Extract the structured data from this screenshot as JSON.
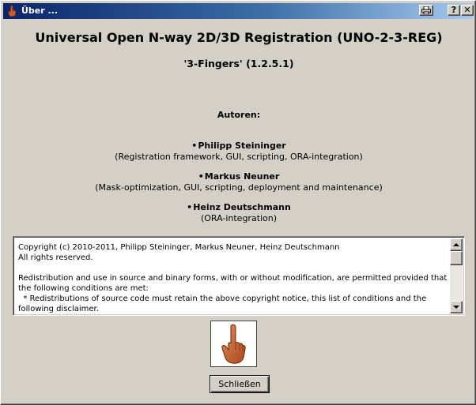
{
  "window": {
    "title": "Über ...",
    "help_label": "?",
    "close_glyph": "✕"
  },
  "app": {
    "title": "Universal Open N-way 2D/3D Registration (UNO-2-3-REG)",
    "version": "'3-Fingers' (1.2.5.1)"
  },
  "authors": {
    "heading": "Autoren:",
    "bullet": "•",
    "list": [
      {
        "name": "Philipp Steininger",
        "role": "(Registration framework, GUI, scripting, ORA-integration)"
      },
      {
        "name": "Markus Neuner",
        "role": "(Mask-optimization, GUI, scripting, deployment and maintenance)"
      },
      {
        "name": "Heinz Deutschmann",
        "role": "(ORA-integration)"
      }
    ]
  },
  "license": {
    "text": "Copyright (c) 2010-2011, Philipp Steininger, Markus Neuner, Heinz Deutschmann\nAll rights reserved.\n\nRedistribution and use in source and binary forms, with or without modification, are permitted provided that the following conditions are met:\n  * Redistributions of source code must retain the above copyright notice, this list of conditions and the following disclaimer.\n  * Redistributions in binary form must reproduce the above copyright notice, this list of conditions and the following disclaimer in the documentation and/or other materials provided with the distribution."
  },
  "buttons": {
    "close_label": "Schließen"
  },
  "icons": {
    "app": "hand-icon",
    "print": "print-icon",
    "logo": "raised-finger-hand-icon"
  },
  "colors": {
    "titlebar_start": "#0a246a",
    "titlebar_end": "#a6caf0",
    "face": "#d4d0c8",
    "hand": "#c8602a"
  }
}
